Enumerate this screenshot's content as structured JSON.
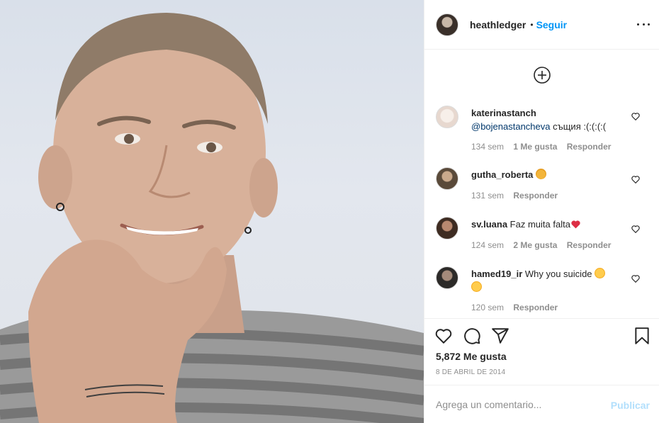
{
  "post": {
    "image_alt": "heathledger post photo",
    "colors": {
      "accent": "#0095f6",
      "mention": "#00376b",
      "muted": "#8e8e8e",
      "publish_disabled": "#b2dffc"
    }
  },
  "header": {
    "username": "heathledger",
    "separator": "•",
    "follow_label": "Seguir",
    "more_icon": "more-options-icon"
  },
  "load_more_icon": "plus-circle-icon",
  "comments": [
    {
      "user": "katerinastanch",
      "mention": "@bojenastancheva",
      "text": " същия :(:(:(:(",
      "time": "134 sem",
      "likes": "1 Me gusta",
      "reply": "Responder"
    },
    {
      "user": "gutha_roberta",
      "text": " ",
      "emoji": "cat-emoji",
      "time": "131 sem",
      "reply": "Responder"
    },
    {
      "user": "sv.luana",
      "text": " Faz muita falta",
      "emoji": "heart-emoji",
      "time": "124 sem",
      "likes": "2 Me gusta",
      "reply": "Responder"
    },
    {
      "user": "hamed19_ir",
      "text": " Why you suicide",
      "emoji": "crying-face-emoji",
      "time": "120 sem",
      "reply": "Responder"
    }
  ],
  "actions": {
    "icons": [
      "heart-icon",
      "comment-icon",
      "share-icon",
      "save-icon"
    ],
    "likes": "5,872 Me gusta",
    "date": "8 DE ABRIL DE 2014"
  },
  "composer": {
    "placeholder": "Agrega un comentario...",
    "publish_label": "Publicar"
  }
}
